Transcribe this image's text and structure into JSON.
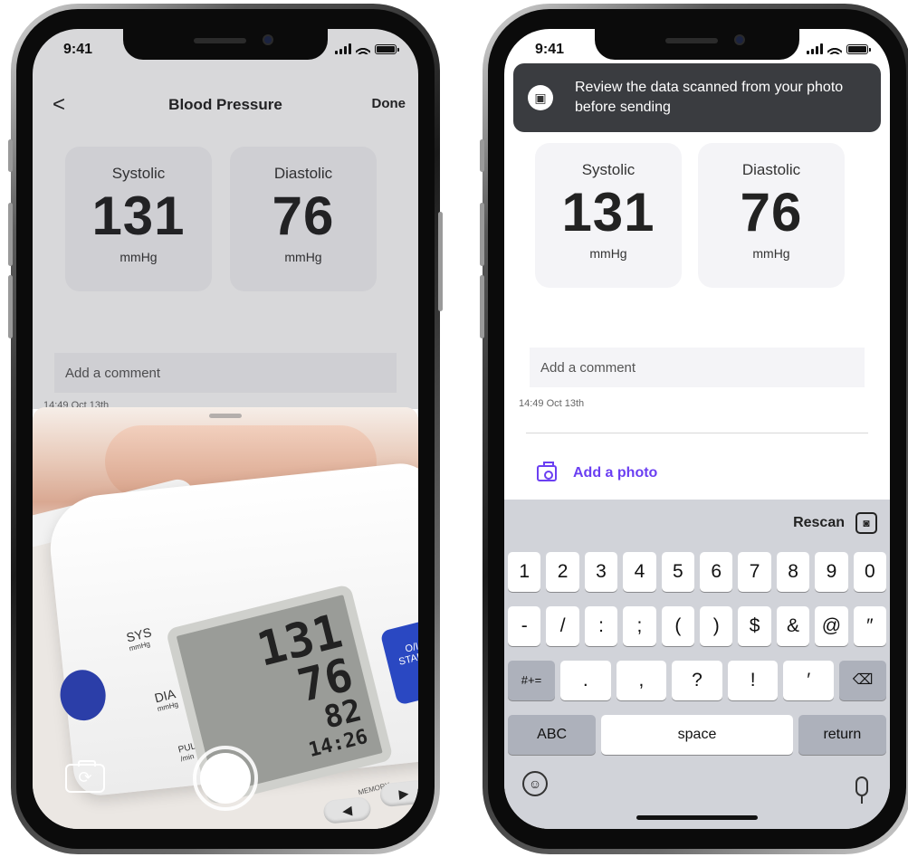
{
  "status": {
    "time": "9:41"
  },
  "screen": {
    "title": "Blood Pressure",
    "back": "<",
    "done": "Done",
    "systolic": {
      "label": "Systolic",
      "value": "131",
      "unit": "mmHg"
    },
    "diastolic": {
      "label": "Diastolic",
      "value": "76",
      "unit": "mmHg"
    },
    "comment_placeholder": "Add a comment",
    "timestamp": "14:49 Oct 13th"
  },
  "camera": {
    "monitor": {
      "sys_label": "SYS",
      "sys_unit": "mmHg",
      "dia_label": "DIA",
      "dia_unit": "mmHg",
      "pulse_label": "PULSE",
      "pulse_unit": "/min",
      "display": [
        "131",
        "76",
        "82",
        "14:26"
      ],
      "start_label": "O/I",
      "start_sub": "START",
      "memory_label": "MEMORY"
    }
  },
  "review": {
    "toast": "Review the data scanned from your photo before sending",
    "add_photo": "Add a photo",
    "rescan": "Rescan"
  },
  "keyboard": {
    "row1": [
      "1",
      "2",
      "3",
      "4",
      "5",
      "6",
      "7",
      "8",
      "9",
      "0"
    ],
    "row2": [
      "-",
      "/",
      ":",
      ";",
      "(",
      ")",
      "$",
      "&",
      "@",
      "″"
    ],
    "row3": [
      ".",
      ",",
      "?",
      "!",
      "′"
    ],
    "mode_symbols": "#+=",
    "mode_abc": "ABC",
    "space": "space",
    "return": "return",
    "delete": "⌫"
  },
  "icons": {
    "back": "chevron-left-icon",
    "camera_flip": "camera-flip-icon",
    "shutter": "shutter-button",
    "toast": "photo-scan-icon",
    "add_photo": "camera-icon",
    "rescan": "scan-camera-icon",
    "emoji": "emoji-icon",
    "mic": "microphone-icon"
  },
  "colors": {
    "accent": "#6b3ff2",
    "toast_bg": "#3a3c40",
    "card_bg": "#f4f4f7",
    "keyboard_bg": "#d1d3d9"
  }
}
